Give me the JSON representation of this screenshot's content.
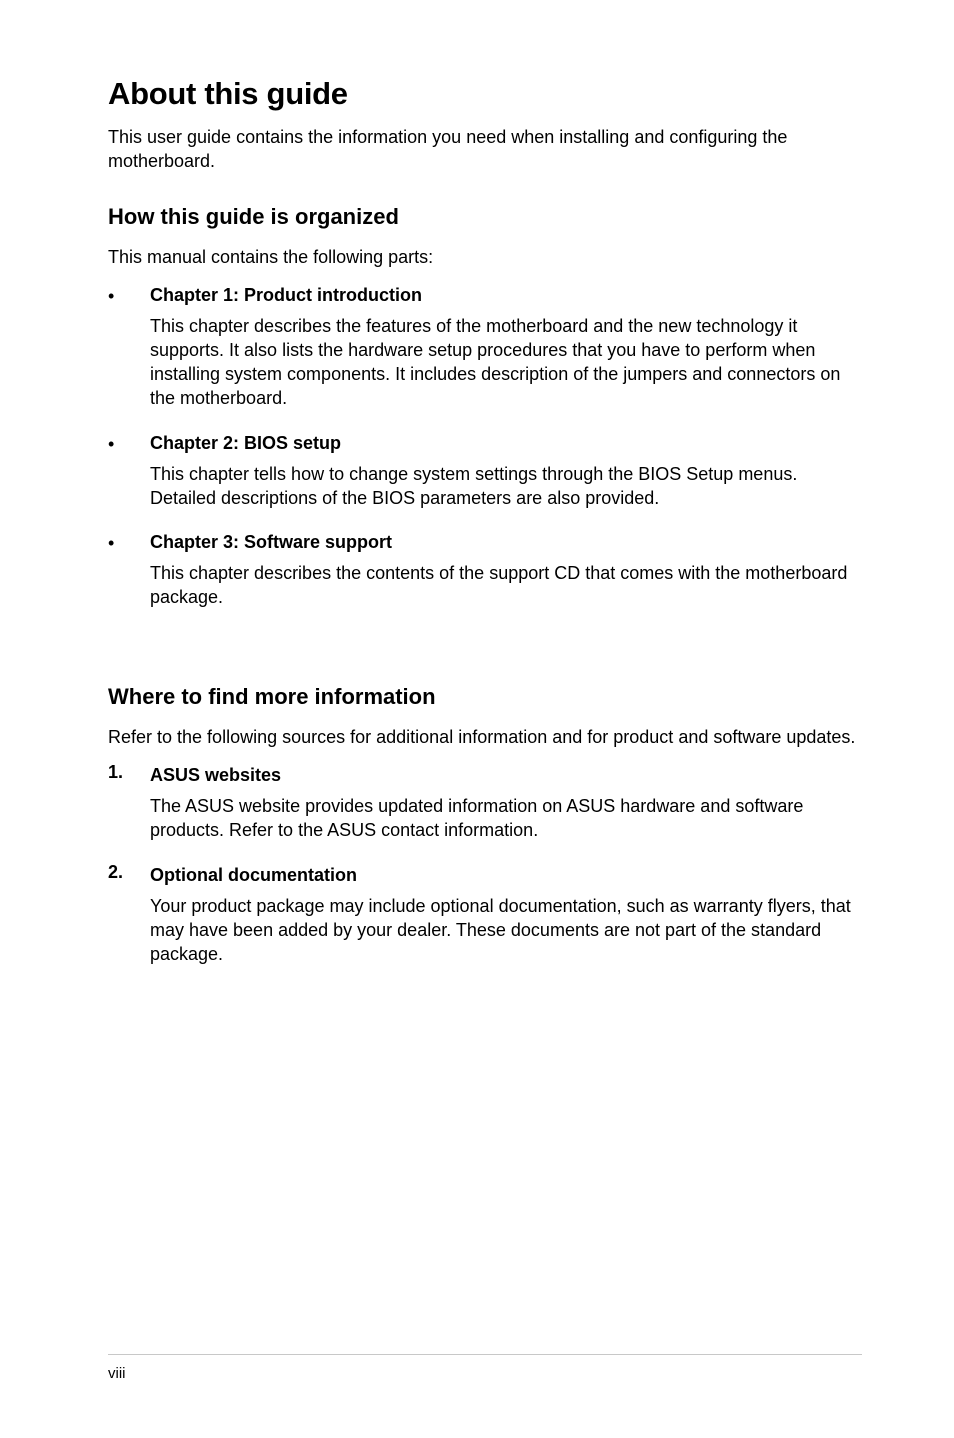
{
  "page_title": "About this guide",
  "intro": "This user guide contains the information you need when installing and configuring the motherboard.",
  "section1": {
    "heading": "How this guide is organized",
    "intro": "This manual contains the following parts:",
    "items": [
      {
        "bullet": "•",
        "title": "Chapter 1: Product introduction",
        "text": "This chapter describes the features of the motherboard and the new technology it supports. It also lists the hardware setup procedures that you have to perform when installing system components. It includes description of the jumpers and connectors on the motherboard."
      },
      {
        "bullet": "•",
        "title": "Chapter 2: BIOS setup",
        "text": "This chapter tells how to change system settings through the BIOS Setup menus. Detailed descriptions of the BIOS parameters are also provided."
      },
      {
        "bullet": "•",
        "title": "Chapter 3: Software support",
        "text": "This chapter describes the contents of the support CD that comes with the motherboard package."
      }
    ]
  },
  "section2": {
    "heading": "Where to find more information",
    "intro": "Refer to the following sources for additional information and for product and software updates.",
    "items": [
      {
        "num": "1.",
        "title": "ASUS websites",
        "text": "The ASUS website provides updated information on ASUS hardware and software products. Refer to the ASUS contact information."
      },
      {
        "num": "2.",
        "title": "Optional documentation",
        "text": "Your product package may include optional documentation, such as warranty flyers, that may have been added by your dealer. These documents are not part of the standard package."
      }
    ]
  },
  "page_number": "viii"
}
